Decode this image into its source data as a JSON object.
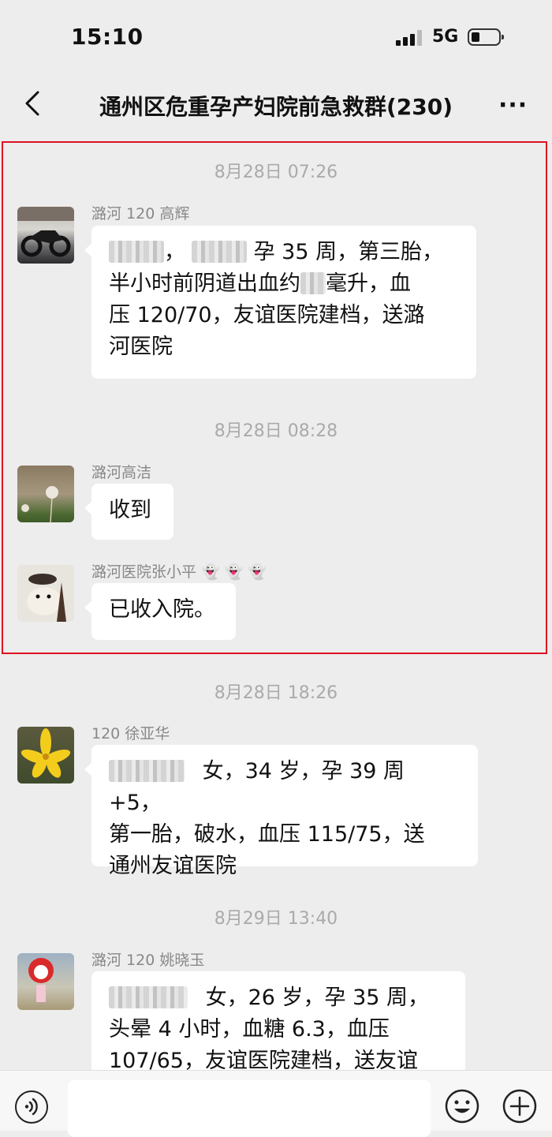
{
  "status_bar": {
    "time": "15:10",
    "network": "5G"
  },
  "header": {
    "back_icon": "chevron-left-icon",
    "title": "通州区危重孕产妇院前急救群(230)",
    "more_icon": "more-dots-icon"
  },
  "messages": [
    {
      "timestamp": "8月28日 07:26",
      "sender": "潞河 120 高辉",
      "lines": [
        "孕 35 周，第三胎，",
        "半小时前阴道出血约",
        "毫升，血",
        "压 120/70，友谊医院建档，送潞",
        "河医院"
      ]
    },
    {
      "timestamp": "8月28日 08:28",
      "sender": "潞河高洁",
      "text": "收到"
    },
    {
      "sender": "潞河医院张小平 👻 👻 👻",
      "text": "已收入院。"
    },
    {
      "timestamp": "8月28日 18:26",
      "sender": "120 徐亚华",
      "lines": [
        "女，34 岁，孕 39 周 +5，",
        "第一胎，破水，血压 115/75，送",
        "通州友谊医院"
      ]
    },
    {
      "timestamp": "8月29日 13:40",
      "sender": "潞河 120 姚晓玉",
      "lines": [
        "女，26 岁，孕 35 周，",
        "头晕 4 小时，血糖 6.3，血压",
        "107/65，友谊医院建档，送友谊"
      ]
    }
  ],
  "input_bar": {
    "voice_icon": "voice-icon",
    "emoji_icon": "emoji-icon",
    "plus_icon": "plus-icon"
  }
}
